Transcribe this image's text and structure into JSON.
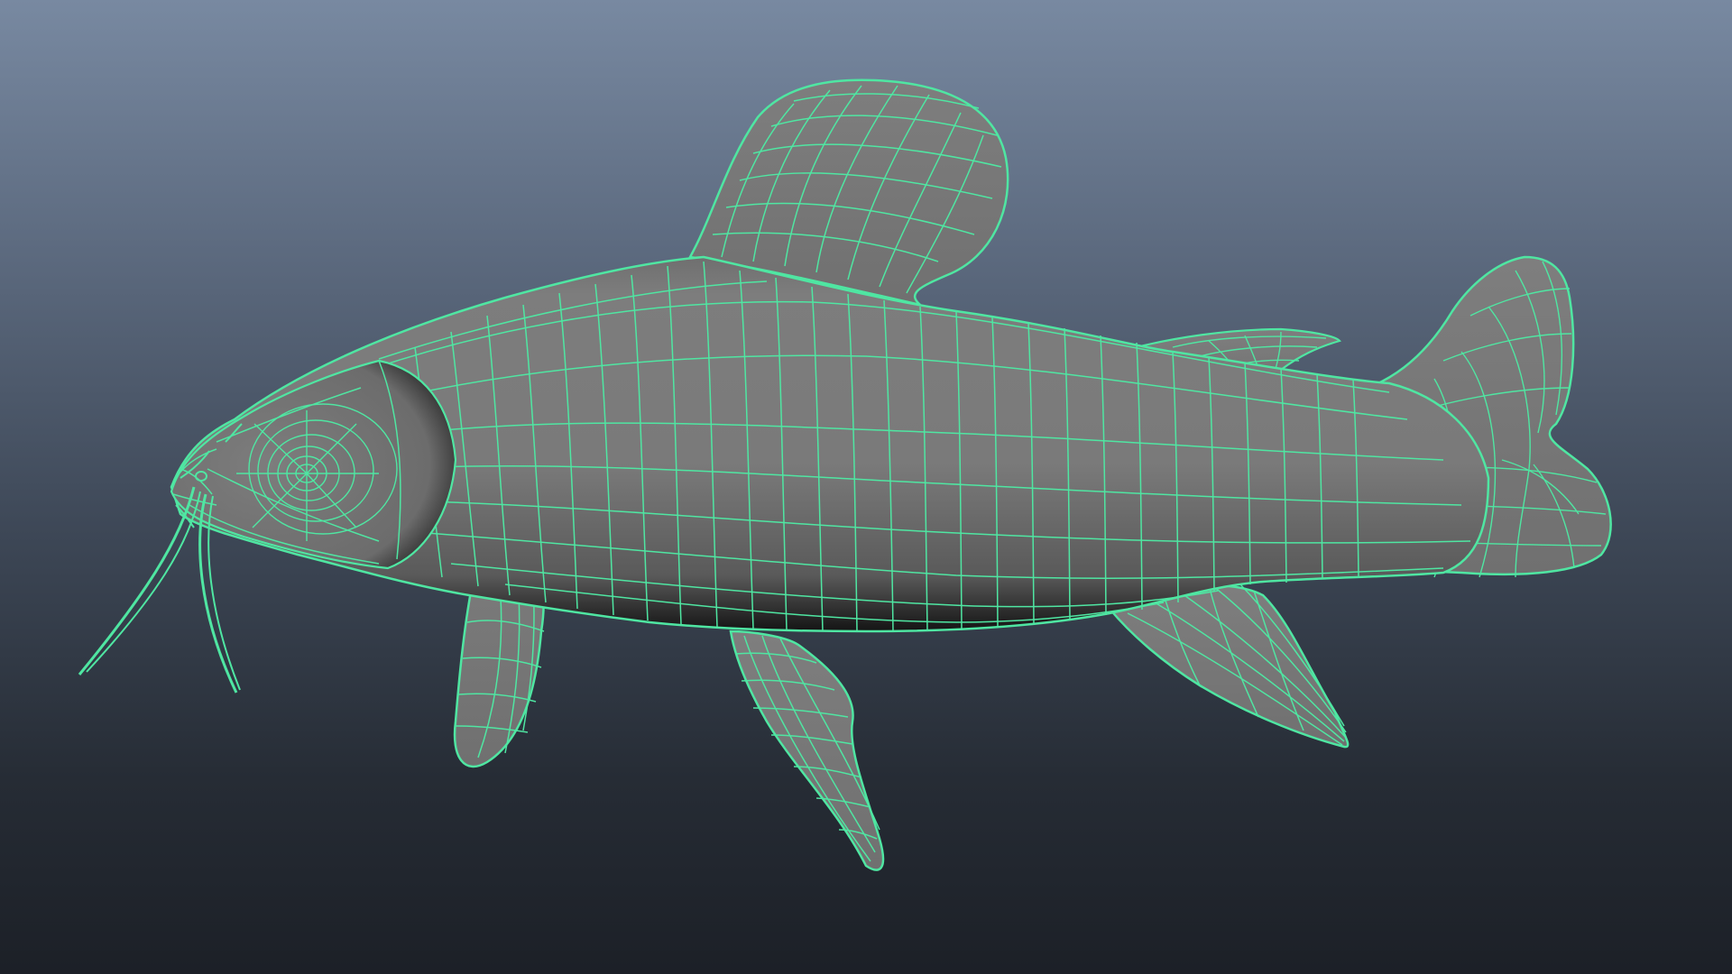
{
  "viewport": {
    "background_top": "#7889a1",
    "background_bottom": "#1c2027",
    "wire_color": "#4fe6a2",
    "surface_color": "#7b7b7b",
    "surface_shadow_color": "#141414"
  },
  "model": {
    "subject": "catfish",
    "display_mode": "wireframe-on-shaded",
    "icon": "mesh-icon"
  }
}
